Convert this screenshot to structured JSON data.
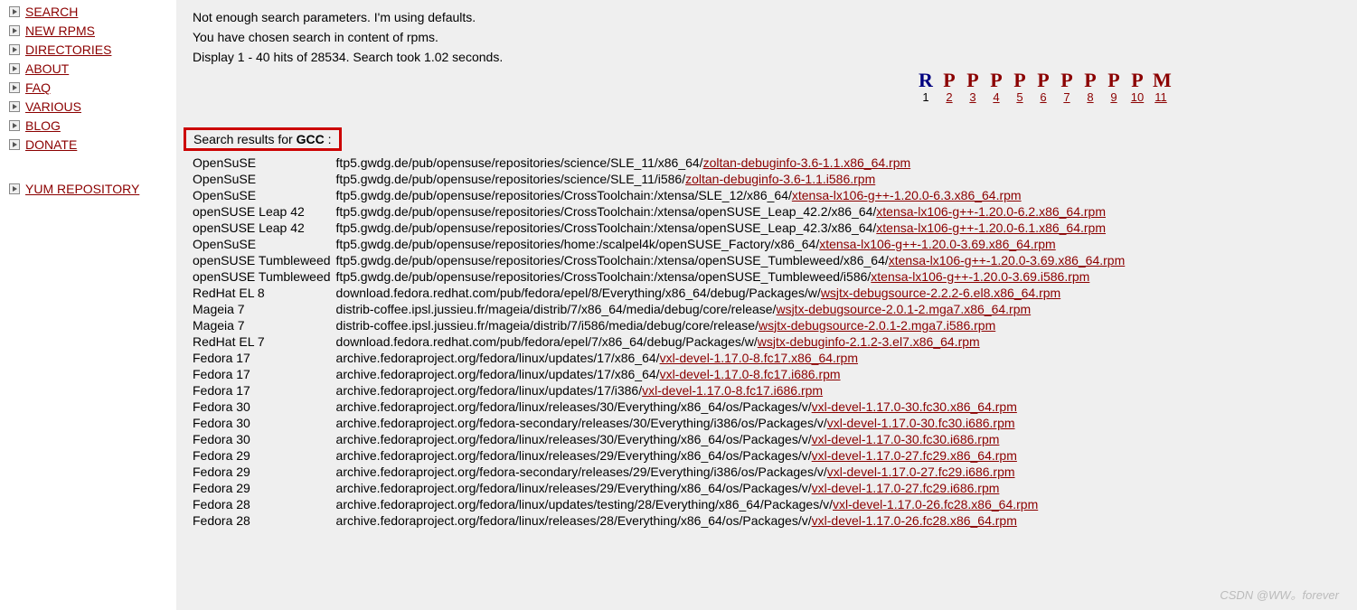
{
  "sidebar": {
    "items": [
      {
        "label": "SEARCH"
      },
      {
        "label": "NEW RPMS"
      },
      {
        "label": "DIRECTORIES"
      },
      {
        "label": "ABOUT"
      },
      {
        "label": "FAQ"
      },
      {
        "label": "VARIOUS"
      },
      {
        "label": "BLOG"
      },
      {
        "label": "DONATE"
      }
    ],
    "secondary": [
      {
        "label": "YUM REPOSITORY"
      }
    ]
  },
  "status": {
    "line1": "Not enough search parameters. I'm using defaults.",
    "line2": "You have chosen search in content of rpms.",
    "line3": "Display 1 - 40 hits of 28534. Search took 1.02 seconds."
  },
  "pagination": [
    {
      "letter": "R",
      "num": "1",
      "current": true
    },
    {
      "letter": "P",
      "num": "2",
      "current": false
    },
    {
      "letter": "P",
      "num": "3",
      "current": false
    },
    {
      "letter": "P",
      "num": "4",
      "current": false
    },
    {
      "letter": "P",
      "num": "5",
      "current": false
    },
    {
      "letter": "P",
      "num": "6",
      "current": false
    },
    {
      "letter": "P",
      "num": "7",
      "current": false
    },
    {
      "letter": "P",
      "num": "8",
      "current": false
    },
    {
      "letter": "P",
      "num": "9",
      "current": false
    },
    {
      "letter": "P",
      "num": "10",
      "current": false
    },
    {
      "letter": "M",
      "num": "11",
      "current": false
    }
  ],
  "search": {
    "heading_prefix": "Search results for ",
    "term": "GCC",
    "heading_suffix": " :"
  },
  "results": [
    {
      "distro": "OpenSuSE",
      "path": "ftp5.gwdg.de/pub/opensuse/repositories/science/SLE_11/x86_64/",
      "rpm": "zoltan-debuginfo-3.6-1.1.x86_64.rpm"
    },
    {
      "distro": "OpenSuSE",
      "path": "ftp5.gwdg.de/pub/opensuse/repositories/science/SLE_11/i586/",
      "rpm": "zoltan-debuginfo-3.6-1.1.i586.rpm"
    },
    {
      "distro": "OpenSuSE",
      "path": "ftp5.gwdg.de/pub/opensuse/repositories/CrossToolchain:/xtensa/SLE_12/x86_64/",
      "rpm": "xtensa-lx106-g++-1.20.0-6.3.x86_64.rpm"
    },
    {
      "distro": "openSUSE Leap 42",
      "path": "ftp5.gwdg.de/pub/opensuse/repositories/CrossToolchain:/xtensa/openSUSE_Leap_42.2/x86_64/",
      "rpm": "xtensa-lx106-g++-1.20.0-6.2.x86_64.rpm"
    },
    {
      "distro": "openSUSE Leap 42",
      "path": "ftp5.gwdg.de/pub/opensuse/repositories/CrossToolchain:/xtensa/openSUSE_Leap_42.3/x86_64/",
      "rpm": "xtensa-lx106-g++-1.20.0-6.1.x86_64.rpm"
    },
    {
      "distro": "OpenSuSE",
      "path": "ftp5.gwdg.de/pub/opensuse/repositories/home:/scalpel4k/openSUSE_Factory/x86_64/",
      "rpm": "xtensa-lx106-g++-1.20.0-3.69.x86_64.rpm"
    },
    {
      "distro": "openSUSE Tumbleweed",
      "path": "ftp5.gwdg.de/pub/opensuse/repositories/CrossToolchain:/xtensa/openSUSE_Tumbleweed/x86_64/",
      "rpm": "xtensa-lx106-g++-1.20.0-3.69.x86_64.rpm"
    },
    {
      "distro": "openSUSE Tumbleweed",
      "path": "ftp5.gwdg.de/pub/opensuse/repositories/CrossToolchain:/xtensa/openSUSE_Tumbleweed/i586/",
      "rpm": "xtensa-lx106-g++-1.20.0-3.69.i586.rpm"
    },
    {
      "distro": "RedHat EL 8",
      "path": "download.fedora.redhat.com/pub/fedora/epel/8/Everything/x86_64/debug/Packages/w/",
      "rpm": "wsjtx-debugsource-2.2.2-6.el8.x86_64.rpm"
    },
    {
      "distro": "Mageia 7",
      "path": "distrib-coffee.ipsl.jussieu.fr/mageia/distrib/7/x86_64/media/debug/core/release/",
      "rpm": "wsjtx-debugsource-2.0.1-2.mga7.x86_64.rpm"
    },
    {
      "distro": "Mageia 7",
      "path": "distrib-coffee.ipsl.jussieu.fr/mageia/distrib/7/i586/media/debug/core/release/",
      "rpm": "wsjtx-debugsource-2.0.1-2.mga7.i586.rpm"
    },
    {
      "distro": "RedHat EL 7",
      "path": "download.fedora.redhat.com/pub/fedora/epel/7/x86_64/debug/Packages/w/",
      "rpm": "wsjtx-debuginfo-2.1.2-3.el7.x86_64.rpm"
    },
    {
      "distro": "Fedora 17",
      "path": "archive.fedoraproject.org/fedora/linux/updates/17/x86_64/",
      "rpm": "vxl-devel-1.17.0-8.fc17.x86_64.rpm"
    },
    {
      "distro": "Fedora 17",
      "path": "archive.fedoraproject.org/fedora/linux/updates/17/x86_64/",
      "rpm": "vxl-devel-1.17.0-8.fc17.i686.rpm"
    },
    {
      "distro": "Fedora 17",
      "path": "archive.fedoraproject.org/fedora/linux/updates/17/i386/",
      "rpm": "vxl-devel-1.17.0-8.fc17.i686.rpm"
    },
    {
      "distro": "Fedora 30",
      "path": "archive.fedoraproject.org/fedora/linux/releases/30/Everything/x86_64/os/Packages/v/",
      "rpm": "vxl-devel-1.17.0-30.fc30.x86_64.rpm"
    },
    {
      "distro": "Fedora 30",
      "path": "archive.fedoraproject.org/fedora-secondary/releases/30/Everything/i386/os/Packages/v/",
      "rpm": "vxl-devel-1.17.0-30.fc30.i686.rpm"
    },
    {
      "distro": "Fedora 30",
      "path": "archive.fedoraproject.org/fedora/linux/releases/30/Everything/x86_64/os/Packages/v/",
      "rpm": "vxl-devel-1.17.0-30.fc30.i686.rpm"
    },
    {
      "distro": "Fedora 29",
      "path": "archive.fedoraproject.org/fedora/linux/releases/29/Everything/x86_64/os/Packages/v/",
      "rpm": "vxl-devel-1.17.0-27.fc29.x86_64.rpm"
    },
    {
      "distro": "Fedora 29",
      "path": "archive.fedoraproject.org/fedora-secondary/releases/29/Everything/i386/os/Packages/v/",
      "rpm": "vxl-devel-1.17.0-27.fc29.i686.rpm"
    },
    {
      "distro": "Fedora 29",
      "path": "archive.fedoraproject.org/fedora/linux/releases/29/Everything/x86_64/os/Packages/v/",
      "rpm": "vxl-devel-1.17.0-27.fc29.i686.rpm"
    },
    {
      "distro": "Fedora 28",
      "path": "archive.fedoraproject.org/fedora/linux/updates/testing/28/Everything/x86_64/Packages/v/",
      "rpm": "vxl-devel-1.17.0-26.fc28.x86_64.rpm"
    },
    {
      "distro": "Fedora 28",
      "path": "archive.fedoraproject.org/fedora/linux/releases/28/Everything/x86_64/os/Packages/v/",
      "rpm": "vxl-devel-1.17.0-26.fc28.x86_64.rpm"
    }
  ],
  "watermark": "CSDN @WW。forever"
}
